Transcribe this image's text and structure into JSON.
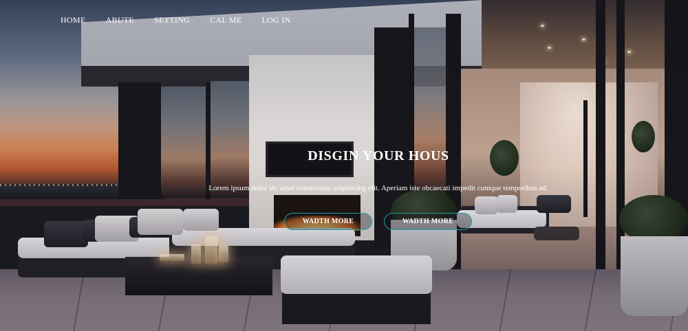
{
  "nav": {
    "items": [
      {
        "label": "HOME"
      },
      {
        "label": "ABUTE"
      },
      {
        "label": "SETTING"
      },
      {
        "label": "CAL ME"
      },
      {
        "label": "LOG IN"
      }
    ]
  },
  "hero": {
    "title": "DISGIN YOUR HOUS",
    "text": "Lorem ipsum dolor sit, amet consectetur adipisicing elit. Aperiam iste obcaecati impedit cumque temporibus ad.",
    "buttons": [
      {
        "label": "WADTH MORE"
      },
      {
        "label": "WADTH MORE"
      }
    ],
    "button_border_color": "#1fa2a8"
  }
}
